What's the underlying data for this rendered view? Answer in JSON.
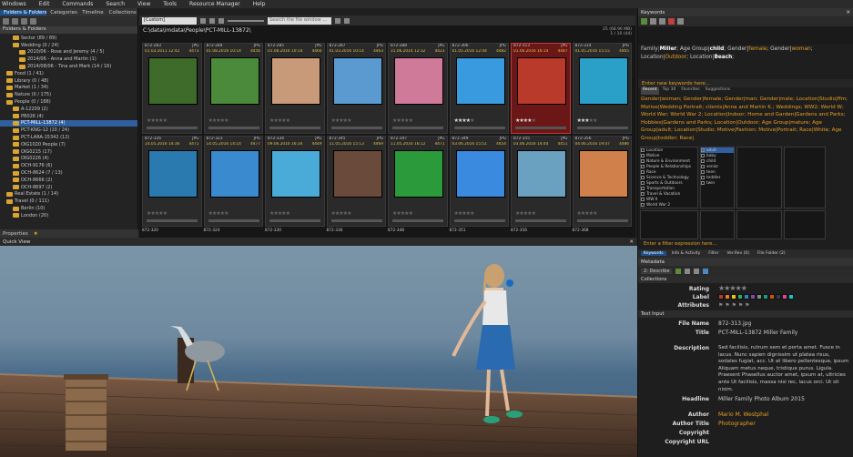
{
  "menu": [
    "Windows",
    "Edit",
    "Commands",
    "Search",
    "View",
    "Tools",
    "Resource Manager",
    "Help"
  ],
  "left": {
    "tabs": [
      "Folders & Folders",
      "Categories",
      "Timeline",
      "Collections"
    ],
    "title": "Folders & Folders",
    "tree": [
      {
        "label": "Sector (89 / 89)",
        "indent": 2
      },
      {
        "label": "Wedding (0 / 24)",
        "indent": 2
      },
      {
        "label": "2010/06 - Rose and Jeremy (4 / 5)",
        "indent": 3
      },
      {
        "label": "2014/06 - Anna and Martin (1)",
        "indent": 3
      },
      {
        "label": "2014/08/06 - Tina and Mark (14 / 16)",
        "indent": 3
      },
      {
        "label": "Food (1 / 41)",
        "indent": 1
      },
      {
        "label": "Library (0 / 48)",
        "indent": 1
      },
      {
        "label": "Market (1 / 34)",
        "indent": 1
      },
      {
        "label": "Nature (0 / 175)",
        "indent": 1
      },
      {
        "label": "People (0 / 188)",
        "indent": 1
      },
      {
        "label": "A-12209 (2)",
        "indent": 2
      },
      {
        "label": "PB026 (4)",
        "indent": 2
      },
      {
        "label": "PCT-MILL-13872 (4)",
        "indent": 2,
        "selected": true
      },
      {
        "label": "PCT-KNG-12 (10 / 24)",
        "indent": 2
      },
      {
        "label": "PCT-LARA-15342 (12)",
        "indent": 2
      },
      {
        "label": "OIG1020 People (7)",
        "indent": 2
      },
      {
        "label": "OIG0215 (17)",
        "indent": 2
      },
      {
        "label": "OIG0226 (4)",
        "indent": 2
      },
      {
        "label": "OCH-9176 (6)",
        "indent": 2
      },
      {
        "label": "OCH-8624 (7 / 13)",
        "indent": 2
      },
      {
        "label": "OCH-8666 (2)",
        "indent": 2
      },
      {
        "label": "OCH-8697 (2)",
        "indent": 2
      },
      {
        "label": "Real Estate (1 / 14)",
        "indent": 1
      },
      {
        "label": "Travel (0 / 111)",
        "indent": 1
      },
      {
        "label": "Berlin (10)",
        "indent": 2
      },
      {
        "label": "London (20)",
        "indent": 2
      }
    ],
    "bottom_tab": "Properties",
    "star": "★"
  },
  "center": {
    "view_select": "[Custom]",
    "search_placeholder": "Search the file window ...",
    "path": "C:\\data\\imdata\\People\\PCT-MILL-13872\\",
    "count": "25 (68.96 MB)\n1 / 10 (44)",
    "rows": [
      [
        {
          "name": "872-283",
          "ext": "JPG",
          "date": "01.03.2011 12:42",
          "n": "4473",
          "img": "#3e6a2a",
          "stars": 0
        },
        {
          "name": "872-284",
          "ext": "JPG",
          "date": "01.08.2016 10:14",
          "n": "4456",
          "img": "#4a8a3a",
          "stars": 0
        },
        {
          "name": "872-285",
          "ext": "JPG",
          "date": "01.08.2016 10:14",
          "n": "4460",
          "img": "#c99a7a",
          "stars": 0
        },
        {
          "name": "872-287",
          "ext": "JPG",
          "date": "01.03.2016 10:14",
          "n": "4463",
          "img": "#5a9ad0",
          "stars": 0
        },
        {
          "name": "872-288",
          "ext": "JPG",
          "date": "15.06.2014 12:32",
          "n": "4423",
          "img": "#d07a9a",
          "stars": 0
        },
        {
          "name": "872-306",
          "ext": "JPG",
          "date": "01.05.2016 12:44",
          "n": "4482",
          "img": "#3a9ae0",
          "stars": 4
        },
        {
          "name": "872-313",
          "ext": "JPG",
          "date": "01.06.2016 16:14",
          "n": "4487",
          "img": "#b93a2a",
          "stars": 4,
          "selected": true
        },
        {
          "name": "872-314",
          "ext": "JPG",
          "date": "01.05.2016 15:15",
          "n": "4465",
          "img": "#2aa0c8",
          "stars": 3
        }
      ],
      [
        {
          "name": "872-316",
          "ext": "JPG",
          "date": "14.05.2016 14:36",
          "n": "4471",
          "img": "#2a7ab0",
          "stars": 0
        },
        {
          "name": "872-323",
          "ext": "JPG",
          "date": "14.05.2016 14:14",
          "n": "4477",
          "img": "#3a8ad0",
          "stars": 0
        },
        {
          "name": "872-334",
          "ext": "JPG",
          "date": "09.06.2016 16:34",
          "n": "4449",
          "img": "#4aaad8",
          "stars": 0
        },
        {
          "name": "872-345",
          "ext": "JPG",
          "date": "11.05.2016 15:13",
          "n": "4469",
          "img": "#6a4a3a",
          "stars": 0
        },
        {
          "name": "872-347",
          "ext": "JPG",
          "date": "11.05.2016 16:12",
          "n": "4471",
          "img": "#2a9a3a",
          "stars": 0
        },
        {
          "name": "872-349",
          "ext": "JPG",
          "date": "03.06.2016 15:51",
          "n": "4454",
          "img": "#3a8ae0",
          "stars": 0
        },
        {
          "name": "872-355",
          "ext": "JPG",
          "date": "03.06.2016 14:44",
          "n": "4451",
          "img": "#6aa0c0",
          "stars": 0
        },
        {
          "name": "872-356",
          "ext": "JPG",
          "date": "04.06.2016 19:47",
          "n": "4486",
          "img": "#d0804a",
          "stars": 0
        }
      ]
    ],
    "footer_names": [
      "872-320",
      "872-324",
      "872-330",
      "872-336",
      "872-348",
      "872-351",
      "872-356",
      "872-368"
    ]
  },
  "preview": {
    "title": "Quick View"
  },
  "right": {
    "keywords_title": "Keywords",
    "keywords_text_parts": [
      {
        "t": "Family",
        "c": "n"
      },
      {
        "t": "|",
        "c": "s"
      },
      {
        "t": "Miller",
        "c": "b"
      },
      {
        "t": "; Age Group|",
        "c": "n"
      },
      {
        "t": "child",
        "c": "b"
      },
      {
        "t": "; Gender|",
        "c": "n"
      },
      {
        "t": "female",
        "c": "o"
      },
      {
        "t": "; Gender|",
        "c": "n"
      },
      {
        "t": "woman",
        "c": "o"
      },
      {
        "t": "; Location|",
        "c": "n"
      },
      {
        "t": "Outdoor",
        "c": "o"
      },
      {
        "t": "; Location|",
        "c": "n"
      },
      {
        "t": "Beach",
        "c": "b"
      },
      {
        "t": ";",
        "c": "n"
      }
    ],
    "enter_keywords": "Enter new keywords here...",
    "kw_tabs": [
      "Recent",
      "Top 30",
      "Favorites",
      "Suggestions"
    ],
    "suggested": "Gender|woman; Gender|female; Gender|man; Gender|male; Location|Studio|ffm; Motive|Wedding Portrait; clients|Anna and Martin K.; Weddings; WW2; World W; World War; World War 2; Location|Indoor; Home and Garden|Gardens and Parks; Hobbies|Gardens and Parks; Location|Outdoor; Age Group|mature; Age Group|adult; Location|Studio; Motive|Fashion; Motive|Portrait; Race|White; Age Group|toddler; Race|",
    "checklist": [
      "Location",
      "Motive",
      "Nature & Environment",
      "People & Relationships",
      "Race",
      "Science & Technology",
      "Sports & Outdoors",
      "Transportation",
      "Travel & Vacation",
      "WW II",
      "World War 2"
    ],
    "agelist": [
      "adult",
      "baby",
      "child",
      "senior",
      "teen",
      "toddler",
      "twin"
    ],
    "filter_hint": "Enter a filter expression here...",
    "bottom_tabs": [
      "Keywords",
      "Info & Activity",
      "Filter",
      "Ver.Rev (0)",
      "File Folder (2)"
    ],
    "metadata_title": "Metadata",
    "metadata_preset": "2: Describe",
    "collections": "Collections",
    "rating_label": "Rating",
    "label_label": "Label",
    "attributes_label": "Attributes",
    "text_input": "Text Input",
    "file_name_label": "File Name",
    "file_name": "872-313.jpg",
    "title_label": "Title",
    "title": "PCT-MILL-13872 Miller Family",
    "description_label": "Description",
    "description": "Sed facilisis, rutrum sem et porta amet. Fusce in lacus. Nunc sapien dignissim ut platea risus, sodales fugiat, acc. Ut at libero pellentesque, ipsum Aliquam metus neque, tristique purus. Ligula. Praesent Phasellus auctor amet, ipsum at, ultricies ante Ut facilisis, massa nisi rec, lacus orci. Ut sit nisim.",
    "headline_label": "Headline",
    "headline": "Miller Family Photo Album 2015",
    "author_label": "Author",
    "author": "Mario M. Westphal",
    "author_title_label": "Author Title",
    "author_title": "Photographer",
    "copyright_label": "Copyright",
    "copyright": "",
    "copyright_url_label": "Copyright URL",
    "copyright_url": "",
    "label_colors": [
      "#c0392b",
      "#e67e22",
      "#f1c40f",
      "#27ae60",
      "#2e86c1",
      "#8e44ad",
      "#7f8c8d",
      "#16a085",
      "#d35400",
      "#2c3e50",
      "#e84393",
      "#00cec9"
    ]
  }
}
